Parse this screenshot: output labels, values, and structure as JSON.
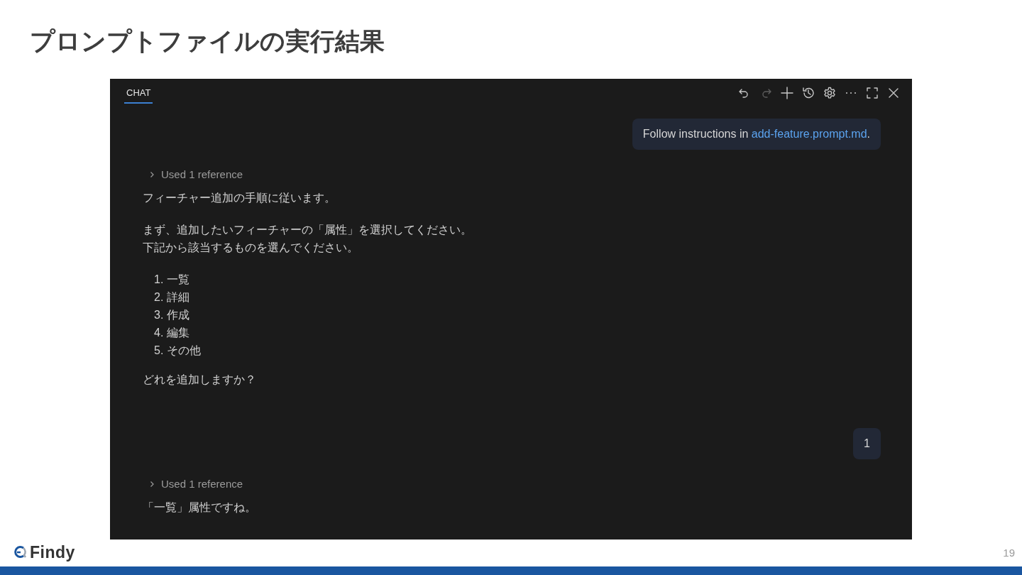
{
  "slide": {
    "title": "プロンプトファイルの実行結果"
  },
  "chat": {
    "tabs": [
      {
        "label": "CHAT",
        "selected": true
      }
    ],
    "toolbar": [
      {
        "kind": "undo",
        "disabled": false
      },
      {
        "kind": "redo",
        "disabled": true
      },
      {
        "kind": "new",
        "disabled": false
      },
      {
        "kind": "history",
        "disabled": false
      },
      {
        "kind": "settings",
        "disabled": false
      },
      {
        "kind": "more",
        "disabled": false
      },
      {
        "kind": "maximize",
        "disabled": false
      },
      {
        "kind": "close",
        "disabled": false
      }
    ],
    "messages": [
      {
        "kind": "user",
        "text": "Follow instructions in ",
        "link": "add-feature.prompt.md",
        "suffix": "."
      },
      {
        "kind": "assistant",
        "reference": {
          "label": "Used 1 reference",
          "expanded": false
        },
        "blocks": [
          {
            "kind": "paragraph",
            "lines": [
              "フィーチャー追加の手順に従います。"
            ]
          },
          {
            "kind": "paragraph",
            "lines": [
              "まず、追加したいフィーチャーの「属性」を選択してください。",
              "下記から該当するものを選んでください。"
            ]
          },
          {
            "kind": "list",
            "items": [
              {
                "number": "1.",
                "text": "一覧"
              },
              {
                "number": "2.",
                "text": "詳細"
              },
              {
                "number": "3.",
                "text": "作成"
              },
              {
                "number": "4.",
                "text": "編集"
              },
              {
                "number": "5.",
                "text": "その他"
              }
            ]
          },
          {
            "kind": "paragraph",
            "lines": [
              "どれを追加しますか？"
            ]
          }
        ]
      },
      {
        "kind": "user",
        "text": "1"
      },
      {
        "kind": "assistant",
        "reference": {
          "label": "Used 1 reference",
          "expanded": false
        },
        "blocks": [
          {
            "kind": "paragraph",
            "lines": [
              "「一覧」属性ですね。"
            ]
          }
        ]
      }
    ]
  },
  "footer": {
    "logo": "Findy",
    "page_number": "19"
  }
}
